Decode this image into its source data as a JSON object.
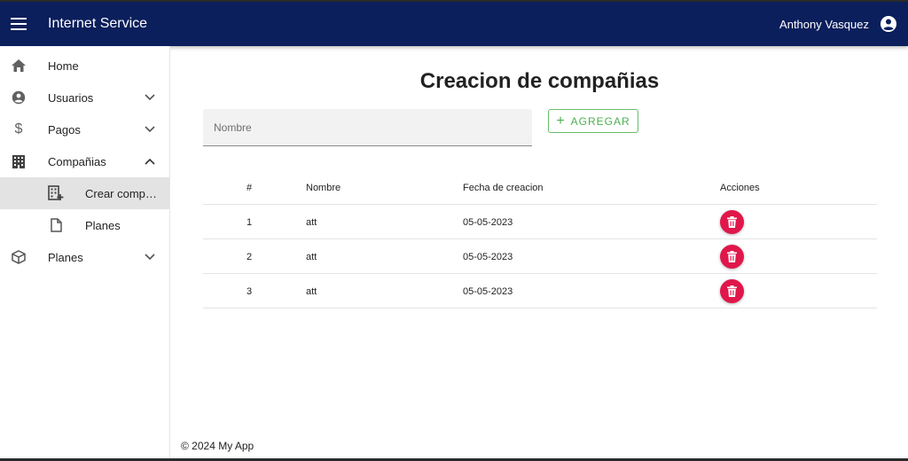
{
  "appbar": {
    "title": "Internet Service",
    "user_name": "Anthony Vasquez",
    "color": "#0b1f5c"
  },
  "sidebar": {
    "items": [
      {
        "label": "Home",
        "icon": "home-icon"
      },
      {
        "label": "Usuarios",
        "icon": "account-circle-icon"
      },
      {
        "label": "Pagos",
        "icon": "dollar-icon"
      },
      {
        "label": "Compañias",
        "icon": "building-icon"
      },
      {
        "label": "Crear compañias",
        "icon": "building-add-icon"
      },
      {
        "label": "Planes",
        "icon": "document-icon"
      },
      {
        "label": "Planes",
        "icon": "package-icon"
      }
    ]
  },
  "main": {
    "title": "Creacion de compañias",
    "name_placeholder": "Nombre",
    "add_label": "AGREGAR"
  },
  "table": {
    "headers": [
      "#",
      "Nombre",
      "Fecha de creacion",
      "Acciones"
    ],
    "rows": [
      {
        "index": "1",
        "name": "att",
        "date": "05-05-2023"
      },
      {
        "index": "2",
        "name": "att",
        "date": "05-05-2023"
      },
      {
        "index": "3",
        "name": "att",
        "date": "05-05-2023"
      }
    ]
  },
  "footer": {
    "text": "© 2024 My App"
  },
  "colors": {
    "accent_green": "#4caf50",
    "delete_red": "#e0174a"
  }
}
